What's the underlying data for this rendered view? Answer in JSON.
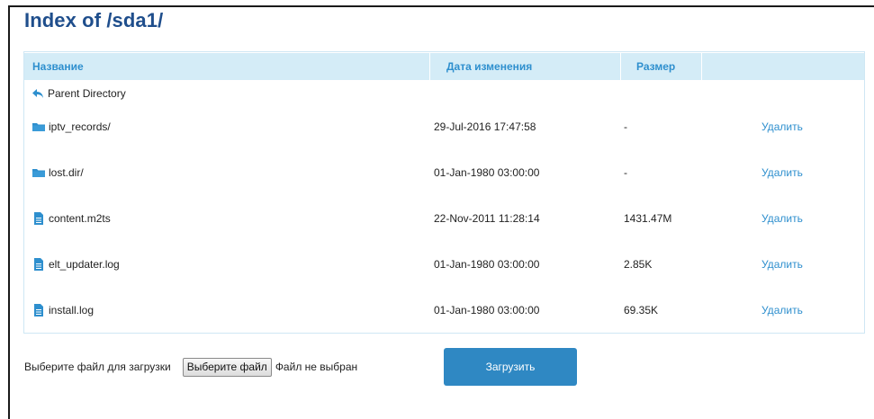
{
  "page": {
    "title": "Index of /sda1/"
  },
  "table": {
    "headers": {
      "name": "Название",
      "date": "Дата изменения",
      "size": "Размер"
    },
    "parent": {
      "label": "Parent Directory",
      "icon": "arrow-back-icon"
    },
    "rows": [
      {
        "name": "iptv_records/",
        "type": "folder",
        "date": "29-Jul-2016 17:47:58",
        "size": "-",
        "action": "Удалить"
      },
      {
        "name": "lost.dir/",
        "type": "folder",
        "date": "01-Jan-1980 03:00:00",
        "size": "-",
        "action": "Удалить"
      },
      {
        "name": "content.m2ts",
        "type": "file",
        "date": "22-Nov-2011 11:28:14",
        "size": "1431.47M",
        "action": "Удалить"
      },
      {
        "name": "elt_updater.log",
        "type": "file",
        "date": "01-Jan-1980 03:00:00",
        "size": "2.85K",
        "action": "Удалить"
      },
      {
        "name": "install.log",
        "type": "file",
        "date": "01-Jan-1980 03:00:00",
        "size": "69.35K",
        "action": "Удалить"
      }
    ]
  },
  "upload": {
    "label": "Выберите файл для загрузки",
    "choose_button": "Выберите файл",
    "status": "Файл не выбран",
    "submit_button": "Загрузить"
  },
  "colors": {
    "accent": "#2e8fce",
    "header_bg": "#d4ecf7",
    "title": "#1f4e8c",
    "button": "#2f88c3"
  }
}
